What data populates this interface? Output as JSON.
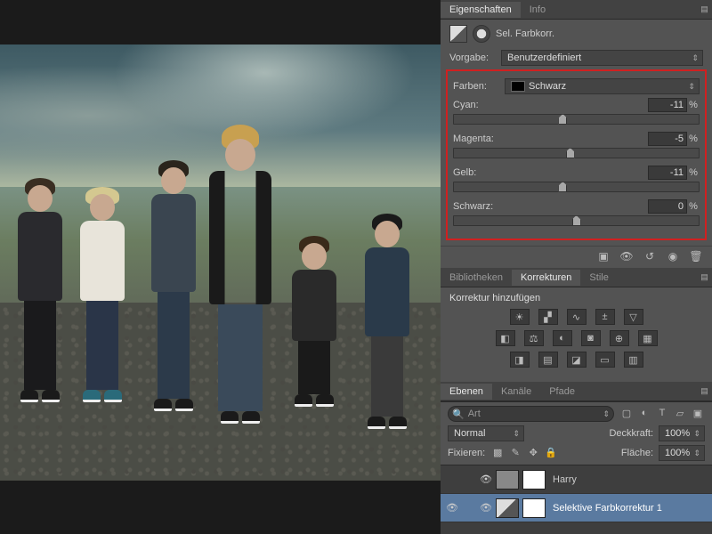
{
  "properties_panel": {
    "tabs": [
      "Eigenschaften",
      "Info"
    ],
    "active_tab": 0,
    "adjustment_title": "Sel. Farbkorr.",
    "preset_label": "Vorgabe:",
    "preset_value": "Benutzerdefiniert",
    "colors_label": "Farben:",
    "colors_value": "Schwarz",
    "sliders": [
      {
        "label": "Cyan:",
        "value": "-11",
        "unit": "%",
        "pos": 44.5
      },
      {
        "label": "Magenta:",
        "value": "-5",
        "unit": "%",
        "pos": 47.5
      },
      {
        "label": "Gelb:",
        "value": "-11",
        "unit": "%",
        "pos": 44.5
      },
      {
        "label": "Schwarz:",
        "value": "0",
        "unit": "%",
        "pos": 50
      }
    ],
    "footer_icons": [
      "clip",
      "view-previous",
      "reset",
      "visibility",
      "delete"
    ]
  },
  "adjustments_panel": {
    "tabs": [
      "Bibliotheken",
      "Korrekturen",
      "Stile"
    ],
    "active_tab": 1,
    "title": "Korrektur hinzufügen",
    "row1": [
      "brightness",
      "levels",
      "curves",
      "exposure",
      "vibrance"
    ],
    "row2": [
      "hue",
      "balance",
      "bw",
      "photo-filter",
      "mixer",
      "lookup"
    ],
    "row3": [
      "invert",
      "posterize",
      "threshold",
      "gradient-map",
      "selective"
    ]
  },
  "layers_panel": {
    "tabs": [
      "Ebenen",
      "Kanäle",
      "Pfade"
    ],
    "active_tab": 0,
    "filter_label": "Art",
    "filter_placeholder": "🔍",
    "filter_icons": [
      "image",
      "adjust",
      "type",
      "shape",
      "smart"
    ],
    "blend_mode": "Normal",
    "opacity_label": "Deckkraft:",
    "opacity_value": "100%",
    "lock_label": "Fixieren:",
    "lock_icons": [
      "transparent",
      "paint",
      "move",
      "all"
    ],
    "fill_label": "Fläche:",
    "fill_value": "100%",
    "layers": [
      {
        "visible": false,
        "fx": true,
        "mask": true,
        "name": "Harry",
        "selected": false,
        "type": "pixel"
      },
      {
        "visible": true,
        "fx": true,
        "mask": true,
        "name": "Selektive Farbkorrektur 1",
        "selected": true,
        "type": "adjustment"
      }
    ]
  }
}
